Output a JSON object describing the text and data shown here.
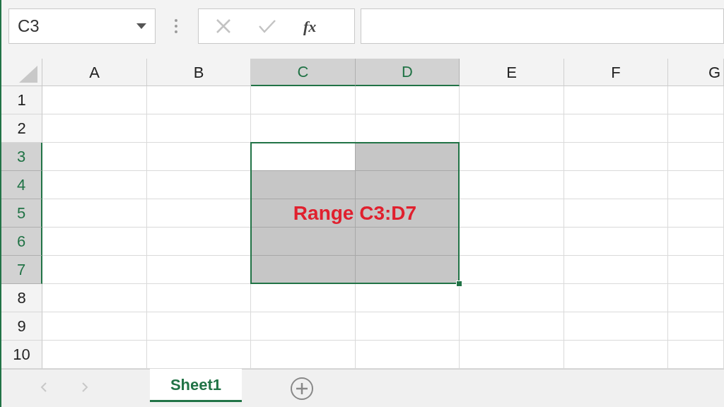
{
  "name_box": {
    "value": "C3"
  },
  "formula_bar": {
    "function_label": "fx"
  },
  "columns": [
    {
      "label": "A",
      "selected": false
    },
    {
      "label": "B",
      "selected": false
    },
    {
      "label": "C",
      "selected": true
    },
    {
      "label": "D",
      "selected": true
    },
    {
      "label": "E",
      "selected": false
    },
    {
      "label": "F",
      "selected": false
    },
    {
      "label": "G",
      "selected": false
    }
  ],
  "rows": [
    {
      "label": "1",
      "selected": false,
      "cells": [
        {
          "selected": false,
          "active": false
        },
        {
          "selected": false,
          "active": false
        },
        {
          "selected": false,
          "active": false
        },
        {
          "selected": false,
          "active": false
        },
        {
          "selected": false,
          "active": false
        },
        {
          "selected": false,
          "active": false
        },
        {
          "selected": false,
          "active": false
        }
      ]
    },
    {
      "label": "2",
      "selected": false,
      "cells": [
        {
          "selected": false,
          "active": false
        },
        {
          "selected": false,
          "active": false
        },
        {
          "selected": false,
          "active": false
        },
        {
          "selected": false,
          "active": false
        },
        {
          "selected": false,
          "active": false
        },
        {
          "selected": false,
          "active": false
        },
        {
          "selected": false,
          "active": false
        }
      ]
    },
    {
      "label": "3",
      "selected": true,
      "cells": [
        {
          "selected": false,
          "active": false
        },
        {
          "selected": false,
          "active": false
        },
        {
          "selected": true,
          "active": true
        },
        {
          "selected": true,
          "active": false
        },
        {
          "selected": false,
          "active": false
        },
        {
          "selected": false,
          "active": false
        },
        {
          "selected": false,
          "active": false
        }
      ]
    },
    {
      "label": "4",
      "selected": true,
      "cells": [
        {
          "selected": false,
          "active": false
        },
        {
          "selected": false,
          "active": false
        },
        {
          "selected": true,
          "active": false
        },
        {
          "selected": true,
          "active": false
        },
        {
          "selected": false,
          "active": false
        },
        {
          "selected": false,
          "active": false
        },
        {
          "selected": false,
          "active": false
        }
      ]
    },
    {
      "label": "5",
      "selected": true,
      "cells": [
        {
          "selected": false,
          "active": false
        },
        {
          "selected": false,
          "active": false
        },
        {
          "selected": true,
          "active": false
        },
        {
          "selected": true,
          "active": false
        },
        {
          "selected": false,
          "active": false
        },
        {
          "selected": false,
          "active": false
        },
        {
          "selected": false,
          "active": false
        }
      ]
    },
    {
      "label": "6",
      "selected": true,
      "cells": [
        {
          "selected": false,
          "active": false
        },
        {
          "selected": false,
          "active": false
        },
        {
          "selected": true,
          "active": false
        },
        {
          "selected": true,
          "active": false
        },
        {
          "selected": false,
          "active": false
        },
        {
          "selected": false,
          "active": false
        },
        {
          "selected": false,
          "active": false
        }
      ]
    },
    {
      "label": "7",
      "selected": true,
      "cells": [
        {
          "selected": false,
          "active": false
        },
        {
          "selected": false,
          "active": false
        },
        {
          "selected": true,
          "active": false
        },
        {
          "selected": true,
          "active": false
        },
        {
          "selected": false,
          "active": false
        },
        {
          "selected": false,
          "active": false
        },
        {
          "selected": false,
          "active": false
        }
      ]
    },
    {
      "label": "8",
      "selected": false,
      "cells": [
        {
          "selected": false,
          "active": false
        },
        {
          "selected": false,
          "active": false
        },
        {
          "selected": false,
          "active": false
        },
        {
          "selected": false,
          "active": false
        },
        {
          "selected": false,
          "active": false
        },
        {
          "selected": false,
          "active": false
        },
        {
          "selected": false,
          "active": false
        }
      ]
    },
    {
      "label": "9",
      "selected": false,
      "cells": [
        {
          "selected": false,
          "active": false
        },
        {
          "selected": false,
          "active": false
        },
        {
          "selected": false,
          "active": false
        },
        {
          "selected": false,
          "active": false
        },
        {
          "selected": false,
          "active": false
        },
        {
          "selected": false,
          "active": false
        },
        {
          "selected": false,
          "active": false
        }
      ]
    },
    {
      "label": "10",
      "selected": false,
      "cells": [
        {
          "selected": false,
          "active": false
        },
        {
          "selected": false,
          "active": false
        },
        {
          "selected": false,
          "active": false
        },
        {
          "selected": false,
          "active": false
        },
        {
          "selected": false,
          "active": false
        },
        {
          "selected": false,
          "active": false
        },
        {
          "selected": false,
          "active": false
        }
      ]
    }
  ],
  "annotation": {
    "text": "Range C3:D7"
  },
  "sheet_tabs": [
    {
      "label": "Sheet1",
      "selected": true
    }
  ]
}
